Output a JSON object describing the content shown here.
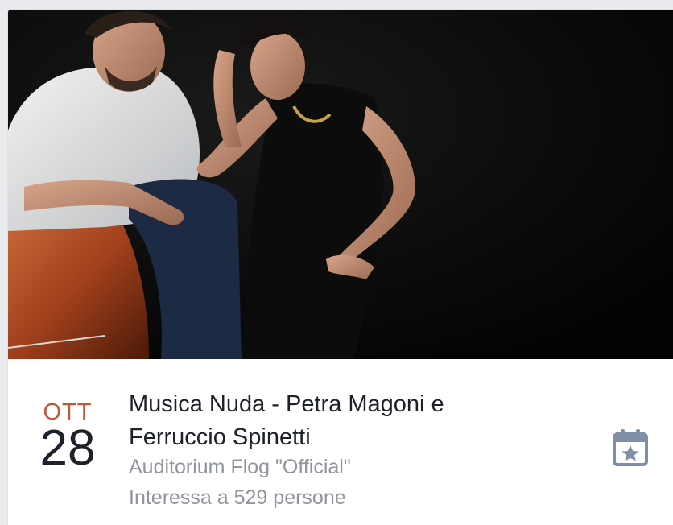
{
  "event": {
    "month": "OTT",
    "day": "28",
    "title": "Musica Nuda - Petra Magoni e Ferruccio Spinetti",
    "venue": "Auditorium Flog \"Official\"",
    "interest": "Interessa a 529 persone"
  },
  "icons": {
    "calendar": "calendar-star-icon"
  },
  "colors": {
    "month": "#c0563b",
    "day": "#1d2129",
    "secondary_text": "#90949c",
    "icon": "#7f8fa6"
  }
}
